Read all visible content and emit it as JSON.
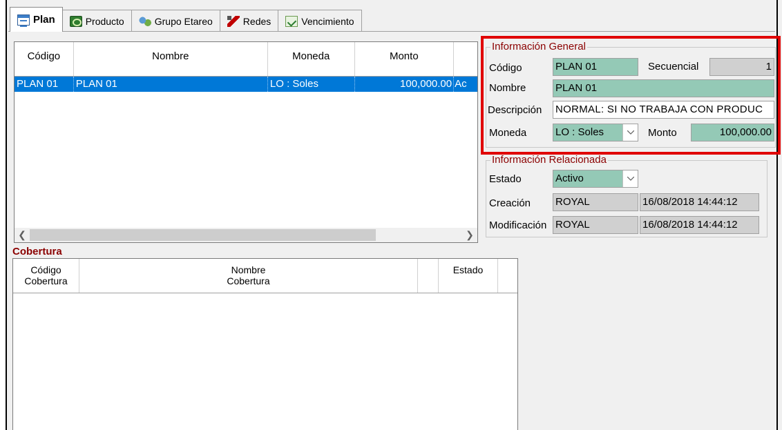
{
  "tabs": [
    {
      "label": "Plan",
      "icon": "plan-icon",
      "active": true
    },
    {
      "label": "Producto",
      "icon": "product-icon"
    },
    {
      "label": "Grupo Etareo",
      "icon": "group-icon"
    },
    {
      "label": "Redes",
      "icon": "network-icon"
    },
    {
      "label": "Vencimiento",
      "icon": "expiration-icon"
    }
  ],
  "plan_grid": {
    "columns": [
      "Código",
      "Nombre",
      "Moneda",
      "Monto"
    ],
    "rows": [
      {
        "codigo": "PLAN 01",
        "nombre": "PLAN 01",
        "moneda": "LO : Soles",
        "monto": "100,000.00",
        "extra": "Ac"
      }
    ]
  },
  "cobertura": {
    "title": "Cobertura",
    "columns": [
      {
        "line1": "Código",
        "line2": "Cobertura"
      },
      {
        "line1": "Nombre",
        "line2": "Cobertura"
      },
      {
        "line1": "",
        "line2": ""
      },
      {
        "line1": "Estado",
        "line2": ""
      }
    ]
  },
  "info_general": {
    "legend": "Información General",
    "codigo_label": "Código",
    "codigo_value": "PLAN 01",
    "secuencial_label": "Secuencial",
    "secuencial_value": "1",
    "nombre_label": "Nombre",
    "nombre_value": "PLAN 01",
    "descripcion_label": "Descripción",
    "descripcion_value": "NORMAL: SI NO TRABAJA CON PRODUC",
    "moneda_label": "Moneda",
    "moneda_value": "LO : Soles",
    "monto_label": "Monto",
    "monto_value": "100,000.00"
  },
  "info_relacionada": {
    "legend": "Información Relacionada",
    "estado_label": "Estado",
    "estado_value": "Activo",
    "creacion_label": "Creación",
    "creacion_user": "ROYAL",
    "creacion_date": "16/08/2018 14:44:12",
    "modificacion_label": "Modificación",
    "modificacion_user": "ROYAL",
    "modificacion_date": "16/08/2018 14:44:12"
  },
  "colors": {
    "selection": "#0078d7",
    "field_teal": "#94c9b6",
    "field_gray": "#d0d0d0",
    "legend_red": "#8b0000",
    "highlight": "#e00000"
  }
}
